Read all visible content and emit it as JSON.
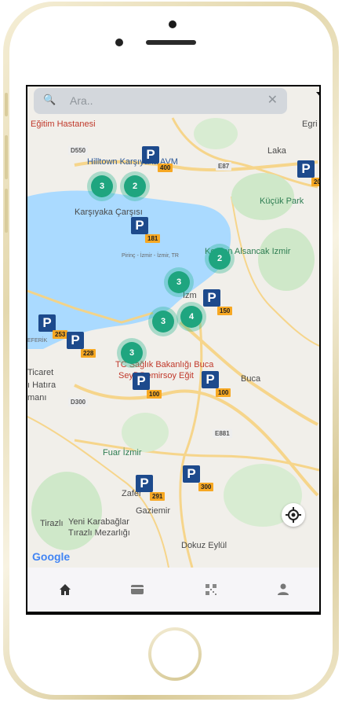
{
  "search": {
    "placeholder": "Ara.."
  },
  "icons": {
    "search": "search-icon",
    "clear": "close-icon",
    "filter": "filter-icon",
    "locate": "my-location-icon",
    "tabs": [
      "home-icon",
      "card-icon",
      "qr-code-icon",
      "person-icon"
    ]
  },
  "map_labels": {
    "egitim_hastanesi": "Eğitim Hastanesi",
    "egri": "Egri",
    "hilltown": "Hilltown Karşıyaka AVM",
    "laka": "Laka",
    "kucuk_park": "Küçük Park",
    "karsiyaka_carsisi": "Karşıyaka Çarşısı",
    "pirinc": "Pirinç - İzmir - İzmir, TR",
    "kordon_alsancak": "Kordon Alsancak Izmir",
    "izmir": "İzm",
    "saglik_bakanligi_1": "TC Sağlık Bakanlığı Buca",
    "saglik_bakanligi_2": "Seyfi Demirsoy Eğit",
    "buca": "Buca",
    "ticaret": "Ticaret",
    "hatira": "ı Hatıra",
    "mani": "manı",
    "eferik": "EFERİK",
    "d550": "D550",
    "e87": "E87",
    "d300": "D300",
    "e881": "E881",
    "road_20": "20",
    "fuar_izmir": "Fuar İzmir",
    "zafer": "Zafer",
    "gaziemir": "Gaziemir",
    "tirazli": "Tirazlı",
    "karabaglar_1": "Yeni Karabağlar",
    "karabaglar_2": "Tırazlı Mezarlığı",
    "dokuz_eylul": "Dokuz Eylül",
    "google": "Google"
  },
  "clusters": [
    {
      "count": "3"
    },
    {
      "count": "2"
    },
    {
      "count": "2"
    },
    {
      "count": "3"
    },
    {
      "count": "3"
    },
    {
      "count": "4"
    },
    {
      "count": "3"
    }
  ],
  "parking_markers": [
    {
      "symbol": "P",
      "capacity": "400"
    },
    {
      "symbol": "P",
      "capacity": "20"
    },
    {
      "symbol": "P",
      "capacity": "181"
    },
    {
      "symbol": "P",
      "capacity": "150"
    },
    {
      "symbol": "P",
      "capacity": "253"
    },
    {
      "symbol": "P",
      "capacity": "228"
    },
    {
      "symbol": "P",
      "capacity": "100"
    },
    {
      "symbol": "P",
      "capacity": "100"
    },
    {
      "symbol": "P",
      "capacity": "291"
    },
    {
      "symbol": "P",
      "capacity": "300"
    }
  ],
  "colors": {
    "cluster": "#1fa57f",
    "parking": "#1d4a8c",
    "capacity_badge": "#f7a823",
    "water": "#aadaff",
    "tabbar": "#f6f5f8"
  }
}
